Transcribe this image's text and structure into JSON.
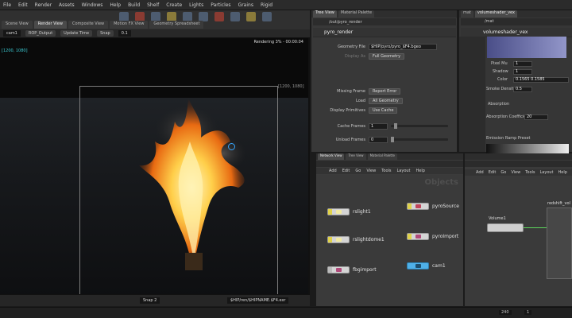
{
  "menubar": [
    "File",
    "Edit",
    "Render",
    "Assets",
    "Windows",
    "Help",
    "Build",
    "Shelf",
    "Create",
    "Lights",
    "Particles",
    "Grains",
    "Rigid"
  ],
  "viewport_tabs": [
    "Scene View",
    "Render View",
    "Composite View",
    "Motion FX View",
    "Geometry Spreadsheet"
  ],
  "viewport_bar": {
    "camera": "cam1",
    "resolution": "ROP_Output",
    "update": "Update Time",
    "snap": "Snap",
    "snap_value": "0.1"
  },
  "viewport": {
    "render_status": "Rendering 3% - 00:00:04",
    "res_readout": "[1200, 1080]",
    "coord_left": "[0, 0]",
    "coord_right": "[1200, 1080]"
  },
  "statusbar": {
    "snapshot": "Snap 2",
    "output_path": "$HIP/ren/$HIPNAME.$F4.exr"
  },
  "param_panel": {
    "tabs": [
      "Tree View",
      "Material Palette"
    ],
    "path": "/out/pyro_render",
    "node": "pyro_render",
    "rows": [
      {
        "label": "Geometry File",
        "value": "$HIP/pyro/pyro_$F4.bgeo"
      },
      {
        "label": "Display As",
        "value": "Full Geometry"
      },
      {
        "label": "Missing Frame",
        "value": "Report Error"
      },
      {
        "label": "Load",
        "value": "All Geometry"
      },
      {
        "label": "Display Primitives",
        "value": "Use Cache"
      },
      {
        "label": "Cache Frames",
        "value": "1"
      },
      {
        "label": "Unload Frames",
        "value": "0"
      }
    ]
  },
  "mat_panel": {
    "tabs": [
      "mat",
      "volumeshader_vex"
    ],
    "path": "/mat",
    "node": "volumeshader_vex",
    "rows": [
      {
        "label": "Pixel Mu",
        "value": "1"
      },
      {
        "label": "Shadow",
        "value": "1"
      },
      {
        "label": "Color",
        "value": "0.1565  0.1585"
      },
      {
        "label": "Smoke Density",
        "value": "0.5"
      },
      {
        "label": "Absorption Coefficient",
        "value": "20"
      },
      {
        "label": "Emission Ramp Preset",
        "value": ""
      }
    ],
    "section": "Absorption"
  },
  "net_panel": {
    "tabs": [
      "Network View",
      "Tree View",
      "Material Palette"
    ],
    "menu": [
      "Add",
      "Edit",
      "Go",
      "View",
      "Tools",
      "Layout",
      "Help"
    ],
    "watermark": "Objects",
    "nodes_left": [
      "rslight1",
      "rslightdome1",
      "fbgimport"
    ],
    "nodes_right": [
      "pyroSource",
      "pyroImport",
      "cam1"
    ]
  },
  "net2_panel": {
    "menu": [
      "Add",
      "Edit",
      "Go",
      "View",
      "Tools",
      "Layout",
      "Help"
    ],
    "node_a": "Volume1",
    "node_b": "redshift_vol"
  },
  "timeline": {
    "start": "1",
    "end": "240",
    "current": "1"
  }
}
